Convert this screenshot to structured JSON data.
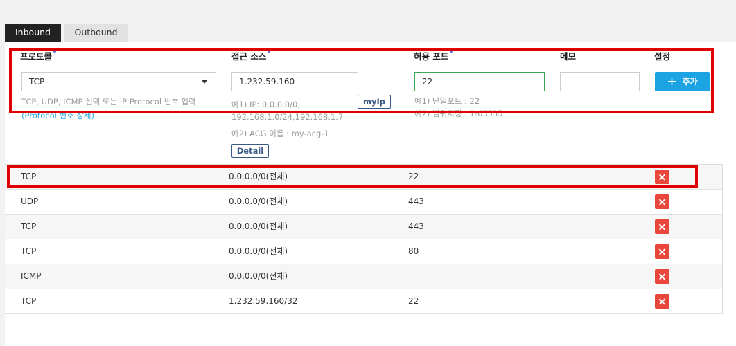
{
  "tabs": [
    {
      "label": "Inbound",
      "active": true
    },
    {
      "label": "Outbound",
      "active": false
    }
  ],
  "form": {
    "headers": {
      "protocol": "프로토콜",
      "source": "접근 소스",
      "port": "허용 포트",
      "memo": "메모",
      "settings": "설정"
    },
    "protocol_value": "TCP",
    "protocol_hint": "TCP, UDP, ICMP 선택 또는 IP Protocol 번호 입력",
    "protocol_link": "(Protocol 번호 상세)",
    "source_value": "1.232.59.160",
    "myip_label": "myIp",
    "source_hint_1": "예1) IP: 0.0.0.0/0,",
    "source_hint_2": "192.168.1.0/24,192.168.1.7",
    "source_hint_3": "예2) ACG 이름 : my-acg-1",
    "detail_label": "Detail",
    "port_value": "22",
    "port_hint_1": "예1) 단일포트 : 22",
    "port_hint_2": "예2) 범위지정 : 1-65535",
    "memo_value": "",
    "add_label": "추가"
  },
  "rules": [
    {
      "protocol": "TCP",
      "source": "0.0.0.0/0(전체)",
      "port": "22"
    },
    {
      "protocol": "UDP",
      "source": "0.0.0.0/0(전체)",
      "port": "443"
    },
    {
      "protocol": "TCP",
      "source": "0.0.0.0/0(전체)",
      "port": "443"
    },
    {
      "protocol": "TCP",
      "source": "0.0.0.0/0(전체)",
      "port": "80"
    },
    {
      "protocol": "ICMP",
      "source": "0.0.0.0/0(전체)",
      "port": ""
    },
    {
      "protocol": "TCP",
      "source": "1.232.59.160/32",
      "port": "22"
    }
  ],
  "colors": {
    "accent": "#1ca3e3",
    "delete": "#e9473b",
    "highlight": "#e00000"
  }
}
